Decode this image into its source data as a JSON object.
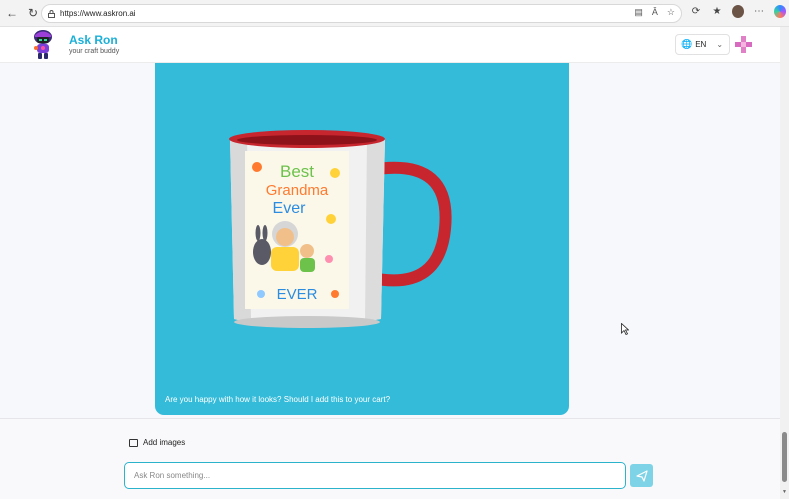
{
  "browser": {
    "url": "https://www.askron.ai"
  },
  "header": {
    "title": "Ask Ron",
    "subtitle": "your craft buddy",
    "language": "EN"
  },
  "message": {
    "caption": "Are you happy with how it looks? Should I add this to your cart?",
    "mug_text": {
      "line1": "Best",
      "line2": "Grandma",
      "line3": "Ever",
      "line4": "EVER"
    }
  },
  "composer": {
    "add_images_label": "Add images",
    "input_placeholder": "Ask Ron something..."
  },
  "colors": {
    "accent": "#1ab0d8",
    "card_bg": "#33bbd9",
    "mug_red": "#c8262f"
  }
}
